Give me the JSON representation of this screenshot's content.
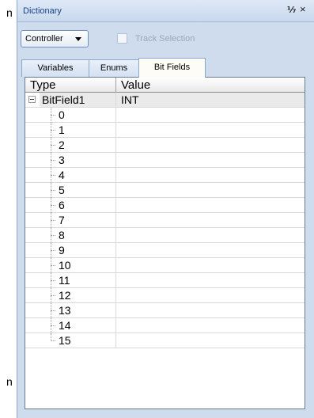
{
  "background": {
    "left_chars": [
      "n",
      "n"
    ]
  },
  "panel": {
    "title": "Dictionary",
    "pin_icon": "window-pin-icon",
    "close_icon": "close-icon",
    "pin_glyph": "⅐",
    "close_glyph": "×"
  },
  "toolbar": {
    "controller_label": "Controller",
    "track_selection_label": "Track Selection",
    "track_selection_checked": false
  },
  "tabs": [
    {
      "label": "Variables",
      "active": false
    },
    {
      "label": "Enums",
      "active": false
    },
    {
      "label": "Bit Fields",
      "active": true
    }
  ],
  "grid": {
    "columns": [
      "Type",
      "Value"
    ],
    "parent": {
      "type": "BitField1",
      "value": "INT"
    },
    "children": [
      "0",
      "1",
      "2",
      "3",
      "4",
      "5",
      "6",
      "7",
      "8",
      "9",
      "10",
      "11",
      "12",
      "13",
      "14",
      "15"
    ]
  },
  "colors": {
    "panel_bg": "#cfdcee",
    "title_text": "#15428b",
    "active_tab": "#fefcf6",
    "disabled_text": "#9aa8bc"
  }
}
